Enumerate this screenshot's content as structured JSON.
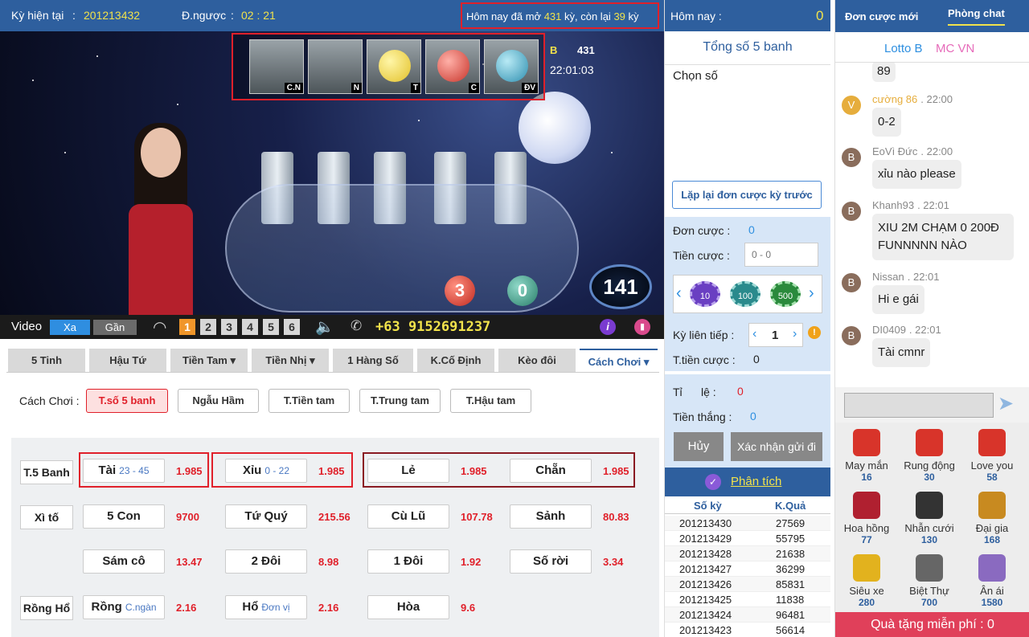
{
  "top": {
    "current_period_label": "Kỳ hiện tại",
    "current_period": "201213432",
    "countdown_label": "Đ.ngược",
    "countdown": "02 : 21",
    "opened_prefix": "Hôm nay đã mở",
    "opened_count": "431",
    "opened_mid": "kỳ, còn lại",
    "remaining_count": "39",
    "opened_suffix": "kỳ"
  },
  "video": {
    "slots": [
      {
        "tag": "C.N"
      },
      {
        "tag": "N"
      },
      {
        "tag": "T"
      },
      {
        "tag": "C"
      },
      {
        "tag": "ĐV"
      }
    ],
    "info_letter": "B",
    "info_number": "431",
    "info_time": "22:01:03",
    "ball_red": "3",
    "ball_green": "0",
    "badge": "141",
    "label": "Video",
    "far_label": "Xa",
    "near_label": "Gần",
    "channels": [
      "1",
      "2",
      "3",
      "4",
      "5",
      "6"
    ],
    "phone": "+63 9152691237"
  },
  "tabs": [
    "5 Tinh",
    "Hậu Tứ",
    "Tiền Tam",
    "Tiền Nhị",
    "1 Hàng Số",
    "K.Cố Định",
    "Kèo đôi",
    "Cách Chơi"
  ],
  "howto": {
    "label": "Cách Chơi :",
    "options": [
      "T.số 5 banh",
      "Ngẫu Hầm",
      "T.Tiền tam",
      "T.Trung tam",
      "T.Hậu tam"
    ]
  },
  "bets": {
    "row_labels": [
      "T.5 Banh",
      "Xì tố",
      "Rồng Hổ"
    ],
    "tai": {
      "label": "Tài",
      "range": "23 - 45",
      "odd": "1.985"
    },
    "xiu": {
      "label": "Xỉu",
      "range": "0 - 22",
      "odd": "1.985"
    },
    "le": {
      "label": "Lẻ",
      "odd": "1.985"
    },
    "chan": {
      "label": "Chẵn",
      "odd": "1.985"
    },
    "r2": [
      {
        "label": "5 Con",
        "odd": "9700"
      },
      {
        "label": "Tứ Quý",
        "odd": "215.56"
      },
      {
        "label": "Cù Lũ",
        "odd": "107.78"
      },
      {
        "label": "Sảnh",
        "odd": "80.83"
      }
    ],
    "r3": [
      {
        "label": "Sám cô",
        "odd": "13.47"
      },
      {
        "label": "2 Đôi",
        "odd": "8.98"
      },
      {
        "label": "1 Đôi",
        "odd": "1.92"
      },
      {
        "label": "Số rời",
        "odd": "3.34"
      }
    ],
    "rong": {
      "label": "Rồng",
      "sub": "C.ngàn",
      "odd": "2.16"
    },
    "ho": {
      "label": "Hổ",
      "sub": "Đơn vị",
      "odd": "2.16"
    },
    "hoa": {
      "label": "Hòa",
      "odd": "9.6"
    }
  },
  "mid": {
    "today_label": "Hôm nay :",
    "today_value": "0",
    "total_label": "Tổng số 5 banh",
    "choose_label": "Chọn số",
    "repeat_button": "Lặp lại đơn cược kỳ trước",
    "orders_label": "Đơn cược :",
    "orders_value": "0",
    "stake_label": "Tiền cược :",
    "stake_placeholder": "0 - 0",
    "chips": [
      "10",
      "100",
      "500"
    ],
    "consec_label": "Kỳ liên tiếp :",
    "consec_value": "1",
    "total_stake_label": "T.tiền cược :",
    "total_stake_value": "0",
    "rate_label": "Tỉ      lệ :",
    "rate_value": "0",
    "win_label": "Tiền thắng :",
    "win_value": "0",
    "cancel_button": "Hủy",
    "confirm_button": "Xác nhận gửi đi",
    "analysis_label": "Phân tích",
    "results_head": [
      "Số kỳ",
      "K.Quả"
    ],
    "results": [
      [
        "201213430",
        "27569"
      ],
      [
        "201213429",
        "55795"
      ],
      [
        "201213428",
        "21638"
      ],
      [
        "201213427",
        "36299"
      ],
      [
        "201213426",
        "85831"
      ],
      [
        "201213425",
        "11838"
      ],
      [
        "201213424",
        "96481"
      ],
      [
        "201213423",
        "56614"
      ]
    ]
  },
  "chat": {
    "tab_new": "Đơn cược mới",
    "tab_chat": "Phòng chat",
    "sub_lotto": "Lotto B",
    "sub_mc": "MC VN",
    "first_bubble": "89",
    "messages": [
      {
        "avatar": "V",
        "name": "cường 86",
        "time": ". 22:00",
        "text": "0-2"
      },
      {
        "avatar": "B",
        "name": "EoVì Đức",
        "time": ". 22:00",
        "text": "xỉu nào please"
      },
      {
        "avatar": "B",
        "name": "Khanh93",
        "time": ". 22:01",
        "text": "XIU 2M CHẠM 0 200Đ FUNNNNN NÀO"
      },
      {
        "avatar": "B",
        "name": "Nissan",
        "time": ". 22:01",
        "text": "Hi e gái"
      },
      {
        "avatar": "B",
        "name": "DI0409",
        "time": ". 22:01",
        "text": "Tài cmnr"
      }
    ],
    "gifts": [
      {
        "name": "May mắn",
        "count": "16"
      },
      {
        "name": "Rung động",
        "count": "30"
      },
      {
        "name": "Love you",
        "count": "58"
      },
      {
        "name": "Hoa hồng",
        "count": "77"
      },
      {
        "name": "Nhẫn cưới",
        "count": "130"
      },
      {
        "name": "Đại gia",
        "count": "168"
      },
      {
        "name": "Siêu xe",
        "count": "280"
      },
      {
        "name": "Biệt Thự",
        "count": "700"
      },
      {
        "name": "Ân ái",
        "count": "1580"
      }
    ],
    "free_gift_label": "Quà tặng miễn phí : 0"
  }
}
